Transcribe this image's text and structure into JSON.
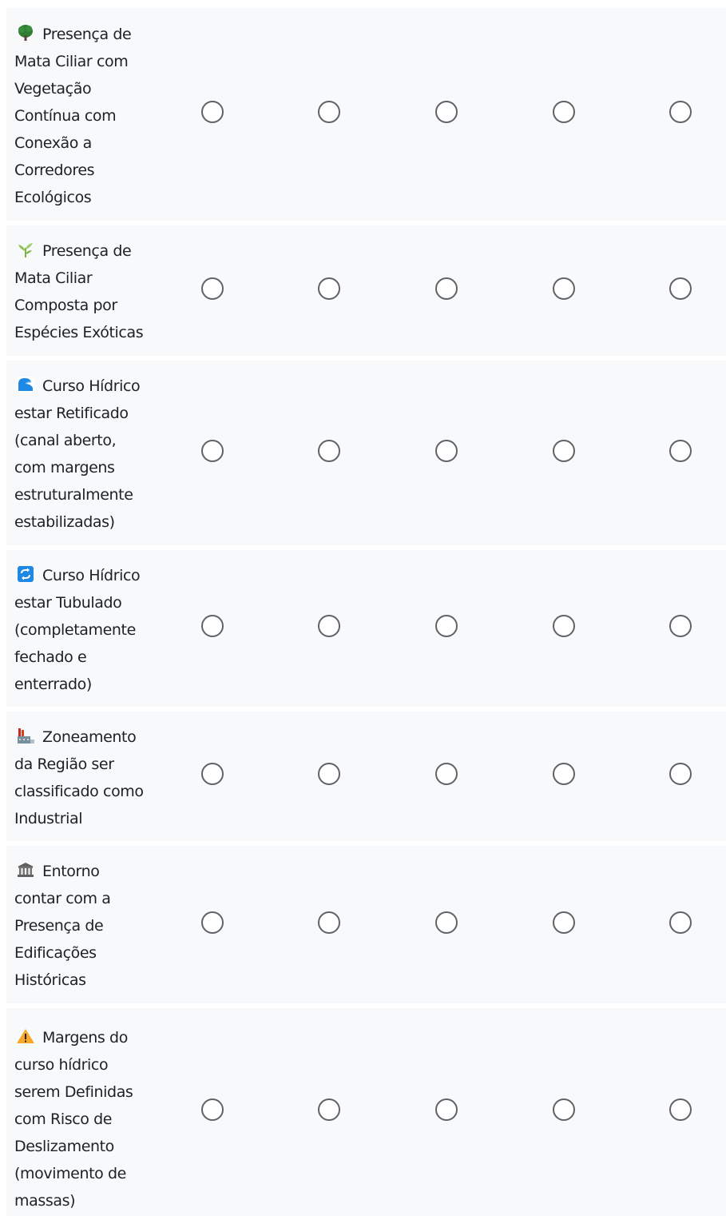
{
  "rows": [
    {
      "icon": "deciduous-tree-icon",
      "label": "Presença de Mata Ciliar com Vegetação Contínua com Conexão a Corredores Ecológicos"
    },
    {
      "icon": "herb-icon",
      "label": "Presença de Mata Ciliar Composta por Espécies Exóticas"
    },
    {
      "icon": "water-wave-icon",
      "label": "Curso Hídrico estar Retificado (canal aberto, com margens estruturalmente estabilizadas)"
    },
    {
      "icon": "arrows-loop-icon",
      "label": "Curso Hídrico estar Tubulado (completamente fechado e enterrado)"
    },
    {
      "icon": "factory-icon",
      "label": "Zoneamento da Região ser classificado como Industrial"
    },
    {
      "icon": "classical-building-icon",
      "label": "Entorno contar com a Presença de Edificações Históricas"
    },
    {
      "icon": "warning-icon",
      "label": "Margens do curso hídrico serem Definidas com Risco de Deslizamento (movimento de massas)"
    }
  ],
  "colors": {
    "row_background": "#f8f9fa",
    "radio_border": "#5f6368",
    "text": "#202124"
  }
}
